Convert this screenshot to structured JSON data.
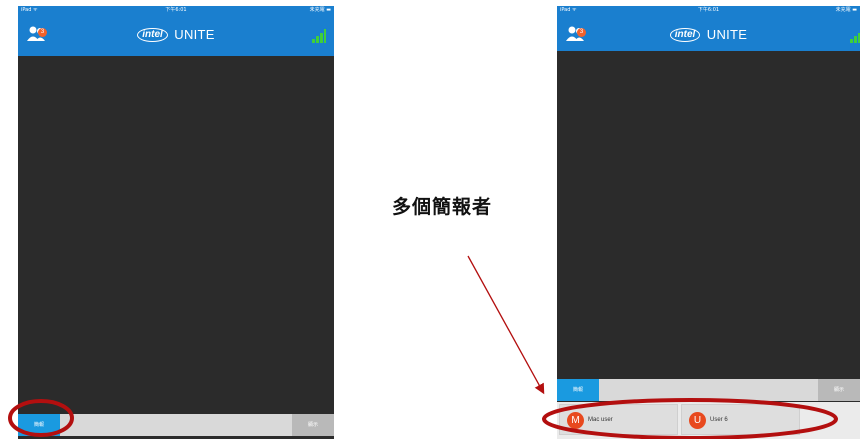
{
  "caption": "多個簡報者",
  "status_bar": {
    "carrier": "iPad ᯤ",
    "time": "下午6:01",
    "battery": "未充電 ▬"
  },
  "app_bar": {
    "user_count": "3",
    "logo_intel": "intel",
    "logo_unite": "UNITE"
  },
  "bottom_bar": {
    "share_label": "簡報",
    "show_label": "顯示"
  },
  "presenters": [
    {
      "initial": "M",
      "name": "Mac user"
    },
    {
      "initial": "U",
      "name": "User 6"
    }
  ],
  "colors": {
    "app_bar": "#1a7fcf",
    "share_tab": "#1a9ae0",
    "content_area": "#2b2b2b",
    "avatar": "#e8491e",
    "signal": "#3fcf3a",
    "annotation": "#b30f0f"
  },
  "icons": {
    "users": "users-icon",
    "signal": "signal-strength-icon"
  }
}
